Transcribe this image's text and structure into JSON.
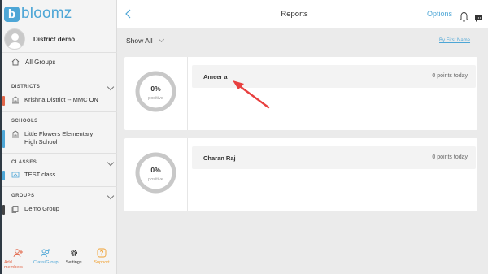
{
  "app": {
    "logo_letter": "b",
    "logo_text": "bloomz"
  },
  "profile": {
    "name": "District demo"
  },
  "sidebar": {
    "all_groups": "All Groups",
    "sections": [
      {
        "title": "DISTRICTS",
        "items": [
          {
            "label": "Krishna District -- MMC ON",
            "color": "#e2674a"
          }
        ]
      },
      {
        "title": "SCHOOLS",
        "items": [
          {
            "label": "Little Flowers Elementary High School",
            "color": "#4da6d6"
          }
        ]
      },
      {
        "title": "CLASSES",
        "items": [
          {
            "label": "TEST class",
            "color": "#4da6d6"
          }
        ]
      },
      {
        "title": "GROUPS",
        "items": [
          {
            "label": "Demo Group",
            "color": "#444444"
          }
        ]
      }
    ],
    "bottom": [
      {
        "label": "Add members",
        "color": "#e2674a",
        "icon": "add-user-icon"
      },
      {
        "label": "Class/Group",
        "color": "#4da6d6",
        "icon": "add-group-icon"
      },
      {
        "label": "Settings",
        "color": "#333333",
        "icon": "gear-icon"
      },
      {
        "label": "Support",
        "color": "#f0a030",
        "icon": "question-icon"
      }
    ]
  },
  "header": {
    "title": "Reports",
    "options": "Options"
  },
  "filter": {
    "label": "Show All",
    "sort": "By First Name"
  },
  "students": [
    {
      "name": "Ameer a",
      "points": "0 points today",
      "percent": "0%",
      "caption": "positive"
    },
    {
      "name": "Charan Raj",
      "points": "0 points today",
      "percent": "0%",
      "caption": "positive"
    }
  ],
  "colors": {
    "accent": "#4da6d6",
    "annotation": "#e8403f"
  }
}
